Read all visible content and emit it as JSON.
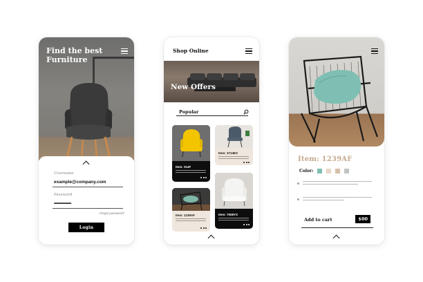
{
  "login": {
    "title": "Find the best Furniture",
    "username_label": "Username",
    "username_value": "example@company.com",
    "password_label": "Password",
    "password_value": "••••••••••••••",
    "forgot_label": "Forgot password?",
    "login_button": "Login"
  },
  "shop": {
    "title": "Shop Online",
    "banner_title": "New Offers",
    "popular_label": "Popular",
    "cards": [
      {
        "item": "Item: 314F",
        "image": "yellow-armchair",
        "color": "#f2c500"
      },
      {
        "item": "Item: 3714EX",
        "image": "grey-chair",
        "color": "#4b5a68"
      },
      {
        "item": "Item: 1239AF",
        "image": "wire-chair-green-cushion",
        "color": "#7fb8a8"
      },
      {
        "item": "Item: 7008YX",
        "image": "white-armchair",
        "color": "#f4f4f2"
      }
    ]
  },
  "product": {
    "item_title": "Item: 1239AF",
    "color_label": "Color:",
    "swatches": [
      "#7fbfb3",
      "#e9d6c6",
      "#d7bfa8",
      "#bfc3c4"
    ],
    "add_to_cart": "Add to cart",
    "price": "$00"
  },
  "colors": {
    "accent_gold": "#c7a98e",
    "dark": "#0d0d0d",
    "card_light": "#efe7dd"
  }
}
